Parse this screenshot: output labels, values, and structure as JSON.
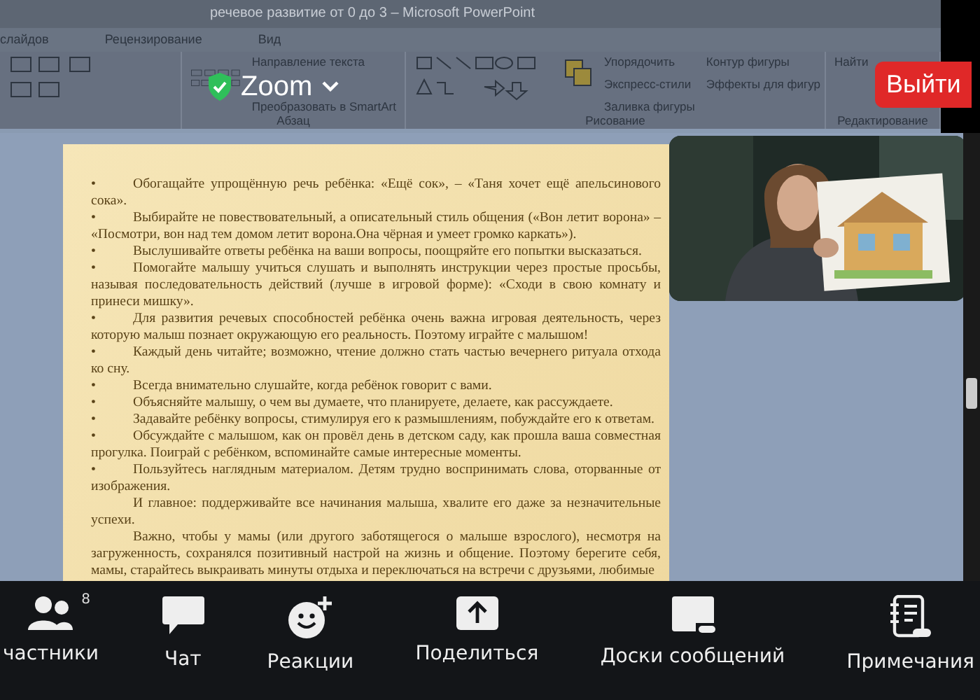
{
  "window": {
    "title": "речевое развитие от 0 до 3 – Microsoft PowerPoint"
  },
  "ribbon": {
    "tabs": [
      "слайдов",
      "Рецензирование",
      "Вид"
    ],
    "groups": [
      {
        "kind": "font"
      },
      {
        "kind": "paragraph",
        "label": "Абзац",
        "items": [
          "Направление текста",
          "Преобразовать в SmartArt"
        ]
      },
      {
        "kind": "drawing",
        "label": "Рисование",
        "items": [
          "Упорядочить",
          "Экспресс-стили",
          "Заливка фигуры",
          "Контур фигуры",
          "Эффекты для фигур"
        ]
      },
      {
        "kind": "editing",
        "label": "Редактирование",
        "items": [
          "Найти"
        ]
      }
    ]
  },
  "overlay": {
    "meeting_label": "Zoom",
    "leave_button": "Выйти"
  },
  "slide": {
    "paragraphs": [
      {
        "marker": "•",
        "text": "Обогащайте упрощённую речь ребёнка: «Ещё сок», – «Таня хочет ещё апельсинового сока»."
      },
      {
        "marker": "•",
        "text": "Выбирайте не повествовательный, а описательный стиль общения («Вон летит ворона» – «Посмотри, вон над тем домом летит ворона.Она чёрная и умеет громко каркать»)."
      },
      {
        "marker": "•",
        "text": "Выслушивайте ответы ребёнка на ваши вопросы, поощряйте его попытки высказаться."
      },
      {
        "marker": "•",
        "text": "Помогайте малышу учиться слушать и выполнять инструкции через простые просьбы, называя последовательность действий (лучше в игровой форме): «Сходи в свою комнату и принеси мишку»."
      },
      {
        "marker": "•",
        "text": "Для развития речевых способностей ребёнка очень важна игровая деятельность, через которую малыш познает окружающую его реальность. Поэтому играйте с малышом!"
      },
      {
        "marker": "•",
        "text": "Каждый день читайте; возможно, чтение должно стать частью вечернего ритуала отхода ко сну."
      },
      {
        "marker": "•",
        "text": "Всегда внимательно слушайте, когда ребёнок говорит с вами."
      },
      {
        "marker": "•",
        "text": "Объясняйте малышу, о чем вы думаете, что планируете, делаете, как рассуждаете."
      },
      {
        "marker": "•",
        "text": "Задавайте ребёнку вопросы, стимулируя его к размышлениям, побуждайте его к ответам."
      },
      {
        "marker": "•",
        "text": "Обсуждайте с малышом, как он провёл день в детском саду, как прошла ваша совместная прогулка. Поиграй с ребёнком, вспоминайте самые интересные моменты."
      },
      {
        "marker": "•",
        "text": "Пользуйтесь наглядным материалом. Детям трудно воспринимать слова, оторванные от изображения."
      },
      {
        "text": "И главное: поддерживайте все начинания малыша, хвалите его даже за незначительные успехи."
      },
      {
        "text": "Важно, чтобы у мамы (или другого заботящегося о малыше взрослого), несмотря на загруженность, сохранялся позитивный настрой на жизнь и общение. Поэтому берегите себя, мамы, старайтесь выкраивать минуты отдыха и переключаться на встречи с друзьями, любимые"
      }
    ]
  },
  "toolbar": {
    "items": [
      {
        "label": "частники",
        "count": "8"
      },
      {
        "label": "Чат"
      },
      {
        "label": "Реакции"
      },
      {
        "label": "Поделиться"
      },
      {
        "label": "Доски сообщений"
      },
      {
        "label": "Примечания"
      }
    ]
  }
}
